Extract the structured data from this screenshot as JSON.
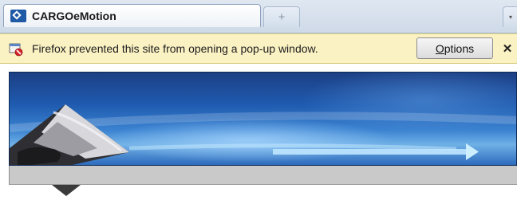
{
  "browser": {
    "tab": {
      "title": "CARGOeMotion",
      "favicon": "cargo-logo-icon"
    },
    "new_tab_symbol": "+",
    "tab_overflow_symbol": "▾"
  },
  "notification": {
    "icon": "popup-blocked-icon",
    "message": "Firefox prevented this site from opening a pop-up window.",
    "options_label": "Options",
    "close_symbol": "✕",
    "background": "#fbf2c3"
  },
  "page": {
    "banner_colors": [
      "#1c3f84",
      "#3a82d0",
      "#6fb0e6"
    ],
    "bar_color": "#c9c9c9"
  }
}
